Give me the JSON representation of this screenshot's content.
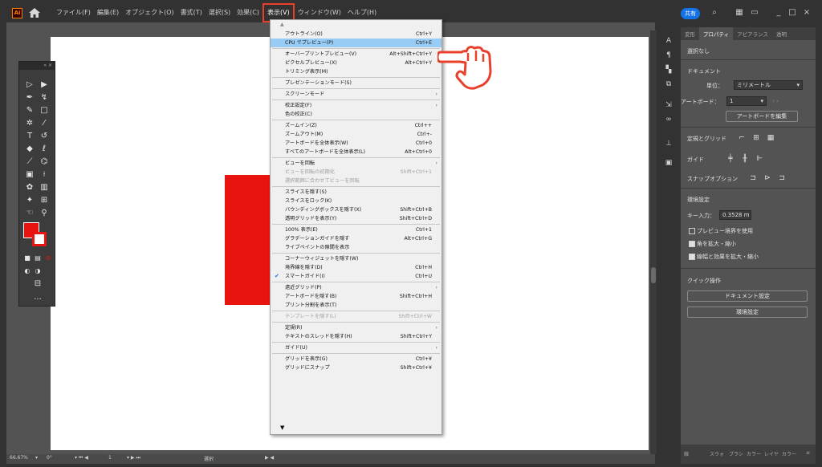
{
  "colors": {
    "accent_highlight": "#99ccf5",
    "menu_active_border": "#e8402a",
    "shape_fill": "#e8140f",
    "share": "#1473e6"
  },
  "titlebar": {
    "logo": "Ai",
    "home_icon": "home-icon",
    "menus": [
      "ファイル(F)",
      "編集(E)",
      "オブジェクト(O)",
      "書式(T)",
      "選択(S)",
      "効果(C)",
      "表示(V)",
      "ウィンドウ(W)",
      "ヘルプ(H)"
    ],
    "share_label": "共有",
    "window_controls": [
      "_",
      "□",
      "×"
    ]
  },
  "view_menu": {
    "items": [
      {
        "label": "アウトライン(O)",
        "shortcut": "Ctrl+Y"
      },
      {
        "label": "CPU でプレビュー(P)",
        "shortcut": "Ctrl+E",
        "highlighted": true
      },
      {
        "sep": true
      },
      {
        "label": "オーバープリントプレビュー(V)",
        "shortcut": "Alt+Shift+Ctrl+Y"
      },
      {
        "label": "ピクセルプレビュー(X)",
        "shortcut": "Alt+Ctrl+Y"
      },
      {
        "label": "トリミング表示(M)",
        "shortcut": ""
      },
      {
        "sep": true
      },
      {
        "label": "プレゼンテーションモード(S)",
        "shortcut": ""
      },
      {
        "sep": true
      },
      {
        "label": "スクリーンモード",
        "shortcut": "",
        "submenu": true
      },
      {
        "sep": true
      },
      {
        "label": "校正設定(F)",
        "shortcut": "",
        "submenu": true
      },
      {
        "label": "色の校正(C)",
        "shortcut": ""
      },
      {
        "sep": true
      },
      {
        "label": "ズームイン(Z)",
        "shortcut": "Ctrl++"
      },
      {
        "label": "ズームアウト(M)",
        "shortcut": "Ctrl+-"
      },
      {
        "label": "アートボードを全体表示(W)",
        "shortcut": "Ctrl+0"
      },
      {
        "label": "すべてのアートボードを全体表示(L)",
        "shortcut": "Alt+Ctrl+0"
      },
      {
        "sep": true
      },
      {
        "label": "ビューを回転",
        "shortcut": "",
        "submenu": true
      },
      {
        "label": "ビューを回転の初期化",
        "shortcut": "Shift+Ctrl+1",
        "disabled": true
      },
      {
        "label": "選択範囲に合わせてビューを回転",
        "shortcut": "",
        "disabled": true
      },
      {
        "sep": true
      },
      {
        "label": "スライスを隠す(S)",
        "shortcut": ""
      },
      {
        "label": "スライスをロック(K)",
        "shortcut": ""
      },
      {
        "label": "バウンディングボックスを隠す(X)",
        "shortcut": "Shift+Ctrl+B"
      },
      {
        "label": "透明グリッドを表示(Y)",
        "shortcut": "Shift+Ctrl+D"
      },
      {
        "sep": true
      },
      {
        "label": "100% 表示(E)",
        "shortcut": "Ctrl+1"
      },
      {
        "label": "グラデーションガイドを隠す",
        "shortcut": "Alt+Ctrl+G"
      },
      {
        "label": "ライブペイントの隙間を表示",
        "shortcut": ""
      },
      {
        "sep": true
      },
      {
        "label": "コーナーウィジェットを隠す(W)",
        "shortcut": ""
      },
      {
        "label": "境界線を隠す(D)",
        "shortcut": "Ctrl+H"
      },
      {
        "label": "スマートガイド(I)",
        "shortcut": "Ctrl+U",
        "checked": true
      },
      {
        "sep": true
      },
      {
        "label": "遠近グリッド(P)",
        "shortcut": "",
        "submenu": true
      },
      {
        "label": "アートボードを隠す(B)",
        "shortcut": "Shift+Ctrl+H"
      },
      {
        "label": "プリント分割を表示(T)",
        "shortcut": ""
      },
      {
        "sep": true
      },
      {
        "label": "テンプレートを隠す(L)",
        "shortcut": "Shift+Ctrl+W",
        "disabled": true
      },
      {
        "sep": true
      },
      {
        "label": "定規(R)",
        "shortcut": "",
        "submenu": true
      },
      {
        "label": "テキストのスレッドを隠す(H)",
        "shortcut": "Shift+Ctrl+Y"
      },
      {
        "sep": true
      },
      {
        "label": "ガイド(U)",
        "shortcut": "",
        "submenu": true
      },
      {
        "sep": true
      },
      {
        "label": "グリッドを表示(G)",
        "shortcut": "Ctrl+¥"
      },
      {
        "label": "グリッドにスナップ",
        "shortcut": "Shift+Ctrl+¥"
      }
    ]
  },
  "status": {
    "zoom": "66.67%",
    "rotation": "0°",
    "artboard": "1",
    "tool": "選択"
  },
  "properties": {
    "tabs": [
      "変形",
      "プロパティ",
      "アピアランス",
      "透明"
    ],
    "no_selection": "選択なし",
    "document_heading": "ドキュメント",
    "units_label": "単位：",
    "units_value": "ミリメートル",
    "artboard_label": "アートボード：",
    "artboard_value": "1",
    "edit_artboard_button": "アートボードを編集",
    "rulers_grids": "定規とグリッド",
    "guides": "ガイド",
    "snap_options": "スナップオプション",
    "prefs_heading": "環境設定",
    "key_increment_label": "キー入力：",
    "key_increment_value": "0.3528 m",
    "preview_bounds": "プレビュー境界を使用",
    "scale_corners": "角を拡大・縮小",
    "scale_strokes": "線幅と効果を拡大・縮小",
    "quick_actions": "クイック操作",
    "doc_setup_button": "ドキュメント設定",
    "prefs_button": "環境設定",
    "bottom_tabs": [
      "線",
      "スウォ",
      "ブラシ",
      "カラー",
      "レイヤ",
      "カラー"
    ]
  }
}
